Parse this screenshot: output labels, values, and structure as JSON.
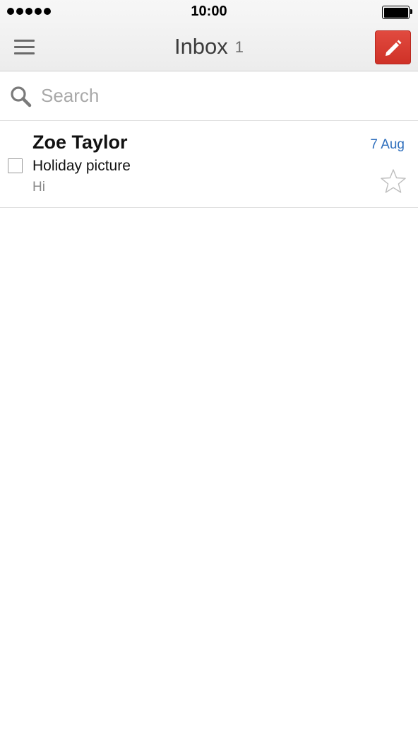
{
  "status_bar": {
    "time": "10:00",
    "signal_bars": 5
  },
  "header": {
    "title": "Inbox",
    "unread_count": "1",
    "menu_icon": "hamburger-menu-icon",
    "compose_icon": "pencil-icon"
  },
  "search": {
    "placeholder": "Search",
    "value": ""
  },
  "messages": [
    {
      "sender": "Zoe Taylor",
      "date": "7 Aug",
      "subject": "Holiday picture",
      "snippet": "Hi",
      "starred": false,
      "checked": false
    }
  ],
  "colors": {
    "compose_accent": "#d93a30",
    "date_link": "#2f6fbd",
    "header_bg": "#f2f2f2"
  }
}
